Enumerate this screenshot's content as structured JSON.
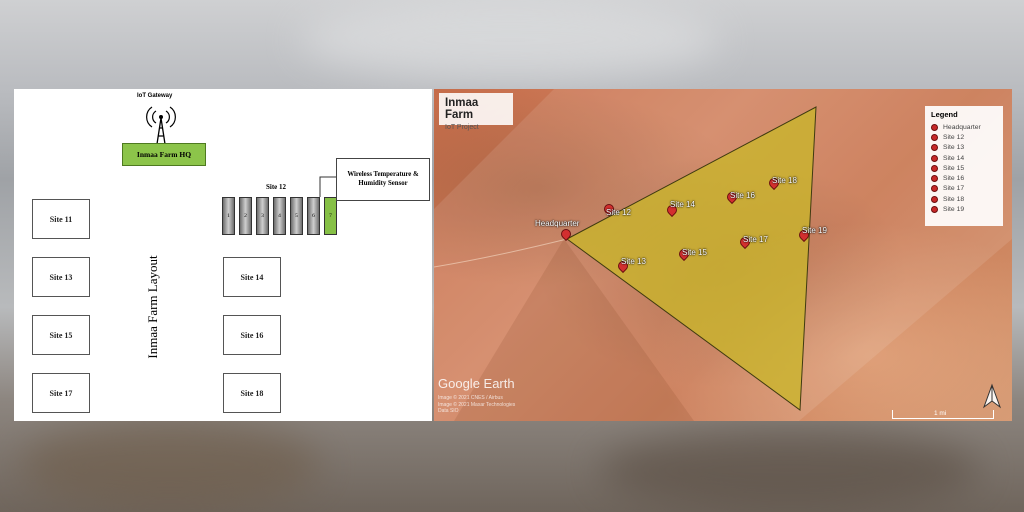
{
  "layout": {
    "gateway_label": "IoT Gateway",
    "hq_label": "Inmaa Farm HQ",
    "site12_title": "Site 12",
    "sensor_callout": "Wireless Temperature & Humidity Sensor",
    "vertical_title": "Inmaa Farm Layout",
    "sensor_cells": [
      "1",
      "2",
      "3",
      "4",
      "5",
      "6",
      "7"
    ],
    "sites_left": [
      "Site 11",
      "Site 13",
      "Site 15",
      "Site 17"
    ],
    "sites_right": [
      "Site 14",
      "Site 16",
      "Site 18"
    ]
  },
  "map": {
    "title": "Inmaa Farm",
    "subtitle": "IoT Project",
    "legend_title": "Legend",
    "legend_items": [
      "Headquarter",
      "Site 12",
      "Site 13",
      "Site 14",
      "Site 15",
      "Site 16",
      "Site 17",
      "Site 18",
      "Site 19"
    ],
    "pins": [
      "Headquarter",
      "Site 12",
      "Site 14",
      "Site 16",
      "Site 18",
      "Site 13",
      "Site 15",
      "Site 17",
      "Site 19"
    ],
    "watermark": "Google Earth",
    "credits": [
      "Image © 2021 CNES / Airbus",
      "Image © 2021 Maxar Technologies",
      "Data SIO"
    ],
    "scale_text": "1 mi",
    "colors": {
      "polygon": "#c9b62a",
      "pin": "#d32f2f",
      "hq_box": "#8cc44a"
    }
  }
}
